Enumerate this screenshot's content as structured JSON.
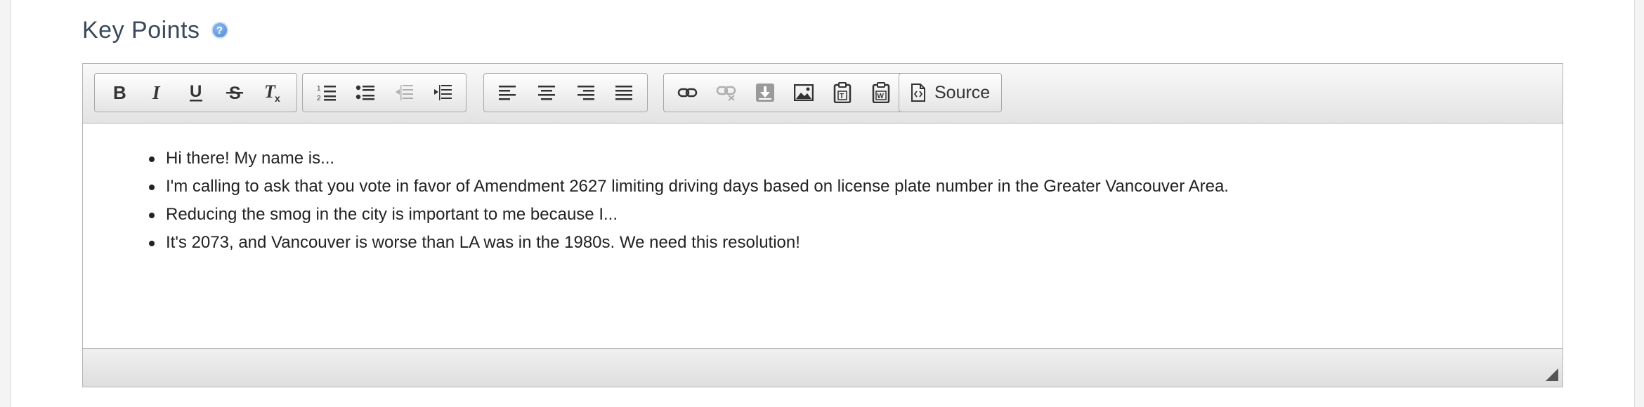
{
  "section": {
    "title": "Key Points",
    "help_icon": "help-icon"
  },
  "toolbar": {
    "groups": [
      {
        "name": "basic-styles",
        "buttons": [
          "bold",
          "italic",
          "underline",
          "strikethrough",
          "remove-format"
        ]
      },
      {
        "name": "lists",
        "buttons": [
          "numbered-list",
          "bulleted-list",
          "outdent",
          "indent"
        ]
      },
      {
        "name": "align",
        "buttons": [
          "align-left",
          "align-center",
          "align-right",
          "justify"
        ]
      },
      {
        "name": "insert",
        "buttons": [
          "link",
          "unlink",
          "anchor",
          "image",
          "paste-text",
          "paste-word"
        ]
      },
      {
        "name": "document",
        "buttons": [
          "source"
        ]
      }
    ],
    "source_label": "Source"
  },
  "content": {
    "items": [
      "Hi there! My name is...",
      "I'm calling to ask that you vote in favor of Amendment 2627 limiting driving days based on license plate number in the Greater Vancouver Area.",
      "Reducing the smog in the city is important to me because I...",
      "It's 2073, and Vancouver is worse than LA was in the 1980s. We need this resolution!"
    ]
  }
}
